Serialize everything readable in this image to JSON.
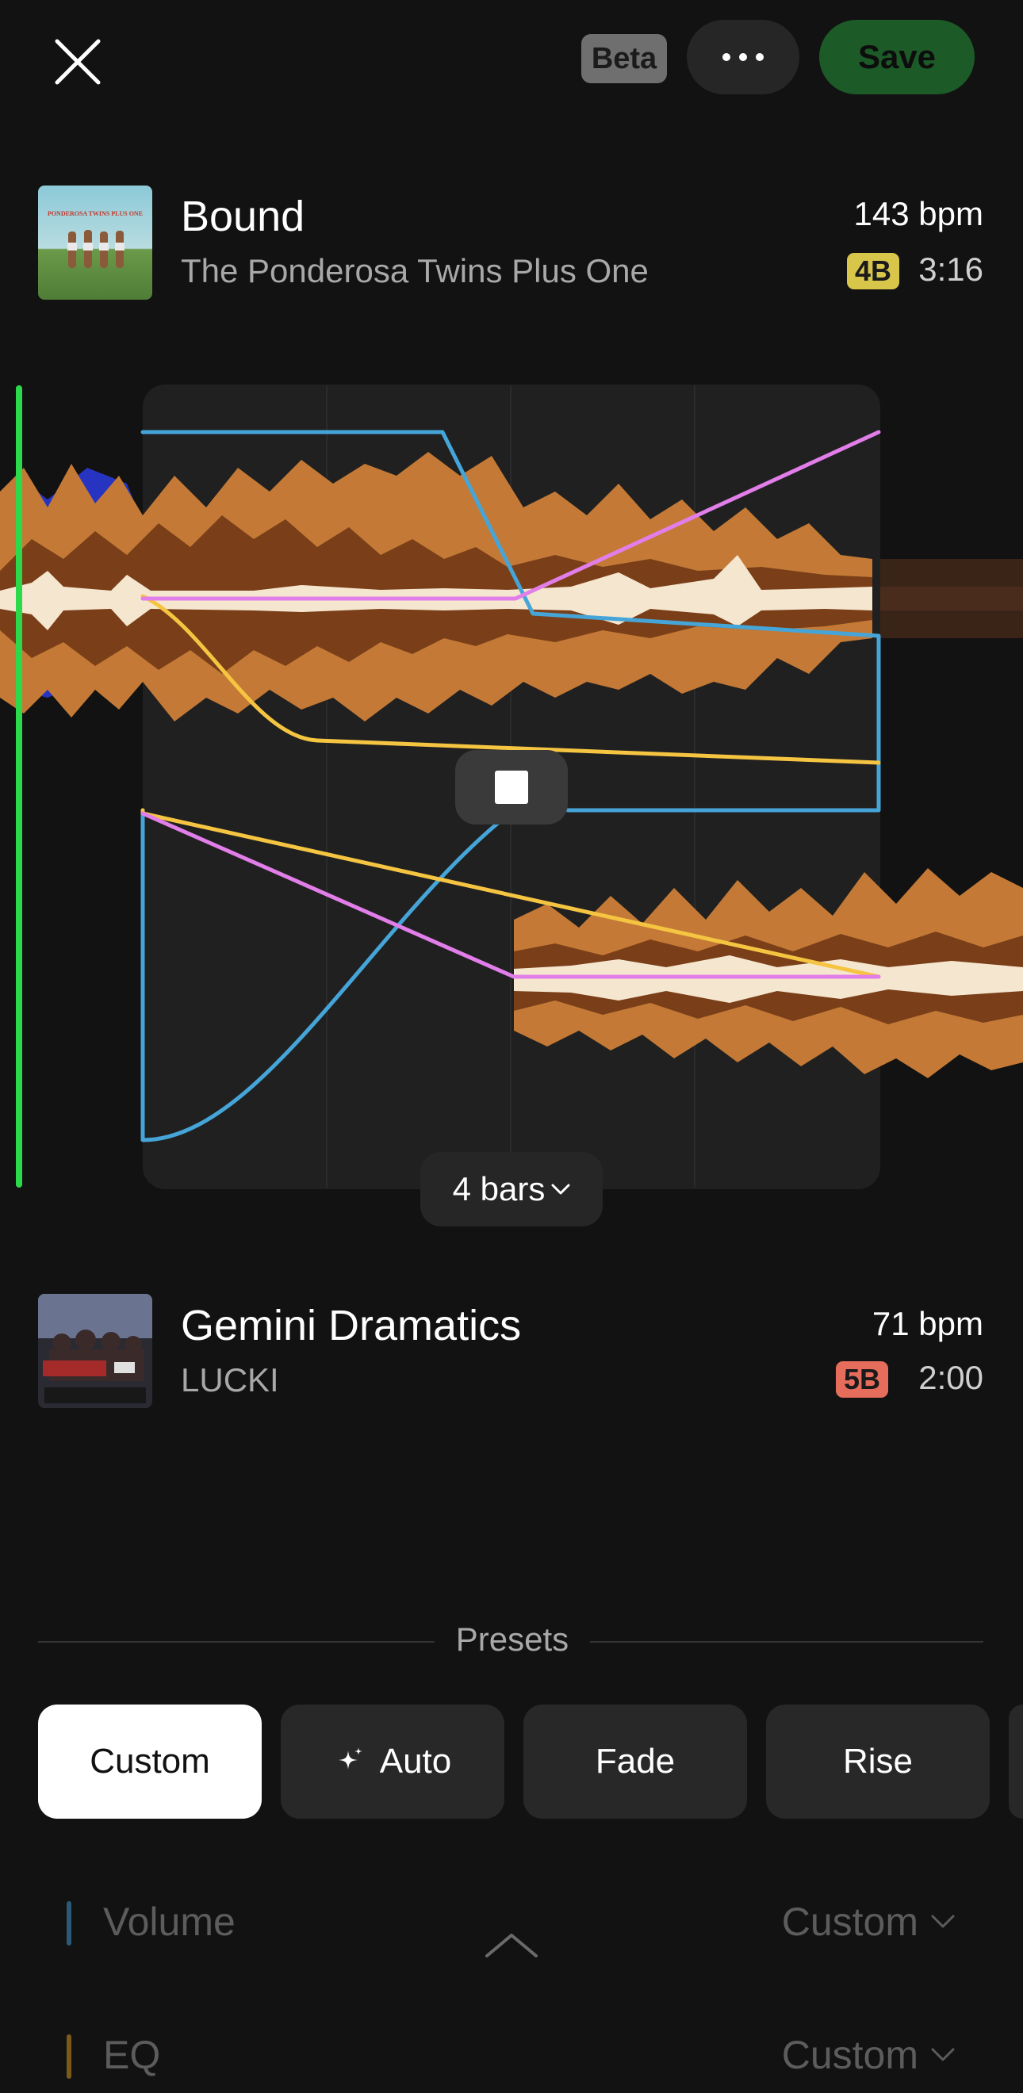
{
  "header": {
    "close_icon": "close-icon",
    "beta_label": "Beta",
    "more_icon": "more-horizontal-icon",
    "save_label": "Save",
    "save_color": "#1c5a27"
  },
  "track_a": {
    "title": "Bound",
    "artist": "The Ponderosa Twins Plus One",
    "bpm": "143 bpm",
    "key": "4B",
    "key_color": "#d8c64b",
    "duration": "3:16",
    "album_art_text": "PONDEROSA TWINS PLUS ONE"
  },
  "track_b": {
    "title": "Gemini Dramatics",
    "artist": "LUCKI",
    "bpm": "71 bpm",
    "key": "5B",
    "key_color": "#e66d5c",
    "duration": "2:00"
  },
  "mixer": {
    "bars_label": "4 bars",
    "stop_icon": "stop-icon",
    "chevron_icon": "chevron-down-icon",
    "colors": {
      "waveform_outer": "#c47a36",
      "waveform_inner": "#7a3f18",
      "waveform_core": "#f5e6d0",
      "volume_curve": "#46a5d8",
      "eq_curve": "#f5c542",
      "effect_curve": "#e27ee9",
      "playhead": "#2bd94a"
    }
  },
  "presets": {
    "label": "Presets",
    "items": [
      {
        "label": "Custom",
        "active": true
      },
      {
        "label": "Auto",
        "icon": "sparkle-icon"
      },
      {
        "label": "Fade"
      },
      {
        "label": "Rise"
      }
    ]
  },
  "settings_rows": [
    {
      "label": "Volume",
      "value": "Custom",
      "color": "#2b5a76"
    },
    {
      "label": "EQ",
      "value": "Custom",
      "color": "#7a5a18"
    }
  ],
  "collapse_icon": "chevron-up-icon"
}
